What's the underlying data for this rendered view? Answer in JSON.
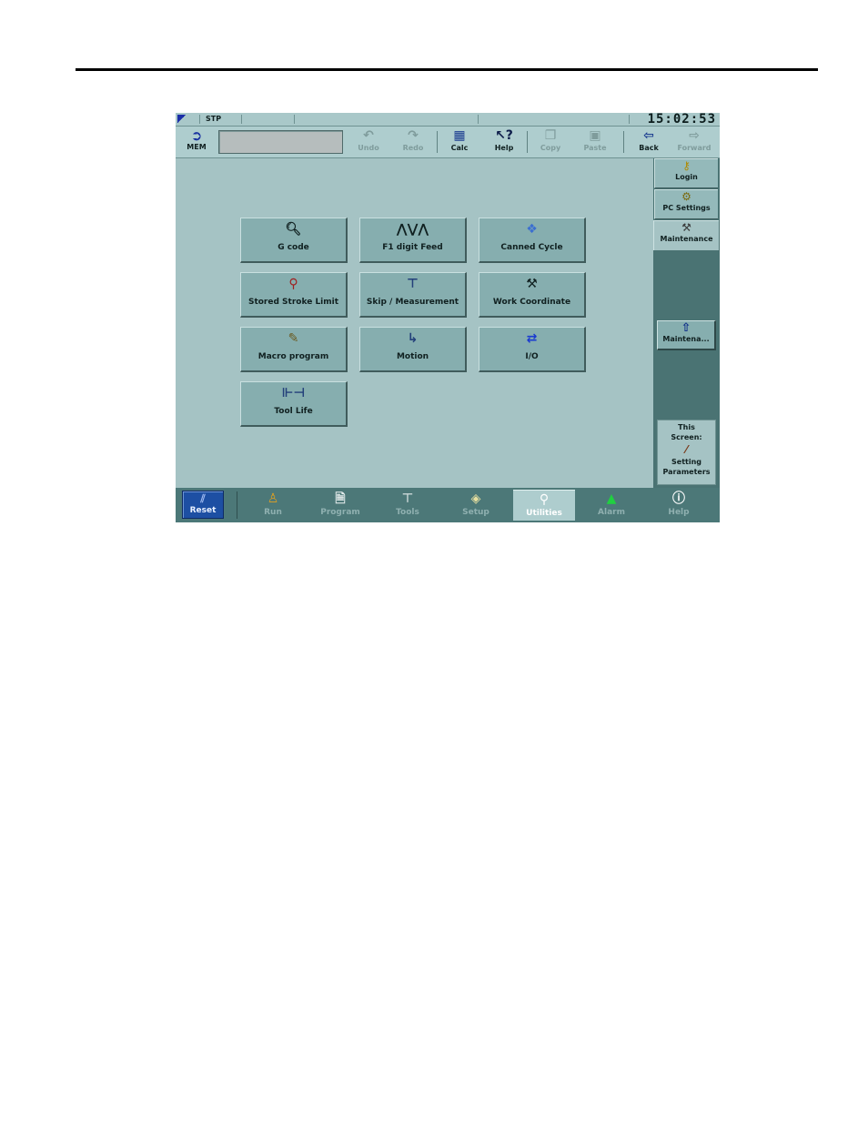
{
  "status": {
    "mode": "STP",
    "clock": "15:02:53"
  },
  "toolbar": {
    "mem_label": "MEM",
    "mem_icon": "mem-icon",
    "buttons": [
      {
        "label": "Undo",
        "icon": "undo-icon",
        "enabled": false
      },
      {
        "label": "Redo",
        "icon": "redo-icon",
        "enabled": false
      },
      {
        "label": "Calc",
        "icon": "calculator-icon",
        "enabled": true
      },
      {
        "label": "Help",
        "icon": "help-icon",
        "enabled": true
      },
      {
        "label": "Copy",
        "icon": "copy-icon",
        "enabled": false
      },
      {
        "label": "Paste",
        "icon": "paste-icon",
        "enabled": false
      },
      {
        "label": "Back",
        "icon": "back-arrow-icon",
        "enabled": true
      },
      {
        "label": "Forward",
        "icon": "forward-arrow-icon",
        "enabled": false
      }
    ]
  },
  "main": {
    "buttons": [
      {
        "label": "G code",
        "icon": "g-code-icon"
      },
      {
        "label": "F1 digit Feed",
        "icon": "feed-icon"
      },
      {
        "label": "Canned Cycle",
        "icon": "canned-cycle-icon"
      },
      {
        "label": "Stored Stroke Limit",
        "icon": "stroke-limit-icon"
      },
      {
        "label": "Skip / Measurement",
        "icon": "skip-measurement-icon"
      },
      {
        "label": "Work Coordinate",
        "icon": "work-coordinate-icon"
      },
      {
        "label": "Macro program",
        "icon": "macro-program-icon"
      },
      {
        "label": "Motion",
        "icon": "motion-icon"
      },
      {
        "label": "I/O",
        "icon": "io-arrows-icon"
      },
      {
        "label": "Tool Life",
        "icon": "tool-life-icon"
      }
    ]
  },
  "right_panel": {
    "tabs": [
      {
        "label": "Login",
        "icon": "key-icon"
      },
      {
        "label": "PC Settings",
        "icon": "pc-settings-icon"
      },
      {
        "label": "Maintenance",
        "icon": "maintenance-icon"
      }
    ],
    "maint_button": {
      "label": "Maintena...",
      "icon": "maintenance-up-icon"
    },
    "this_screen": {
      "line1": "This",
      "line2": "Screen:",
      "icon": "screwdriver-icon",
      "line3": "Setting",
      "line4": "Parameters"
    }
  },
  "bottom_nav": {
    "reset_label": "Reset",
    "items": [
      {
        "label": "Run",
        "icon": "run-icon",
        "active": false
      },
      {
        "label": "Program",
        "icon": "program-icon",
        "active": false
      },
      {
        "label": "Tools",
        "icon": "tools-icon",
        "active": false
      },
      {
        "label": "Setup",
        "icon": "setup-icon",
        "active": false
      },
      {
        "label": "Utilities",
        "icon": "utilities-icon",
        "active": true
      },
      {
        "label": "Alarm",
        "icon": "alarm-light-icon",
        "active": false
      },
      {
        "label": "Help",
        "icon": "info-icon",
        "active": false
      }
    ]
  },
  "colors": {
    "screen_bg": "#a5c3c4",
    "button_face": "#86aeaf",
    "panel_dark": "#4a7373",
    "reset_blue": "#1d4fa3"
  }
}
